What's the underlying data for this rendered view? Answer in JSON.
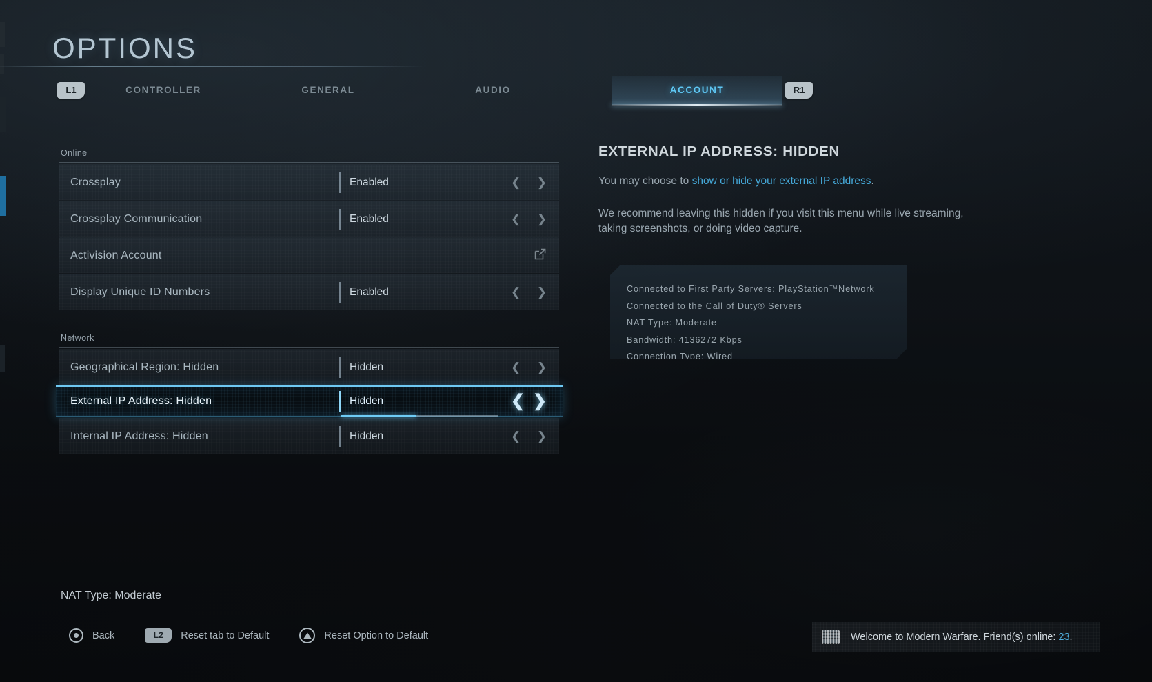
{
  "header": {
    "title": "OPTIONS"
  },
  "tabs": {
    "left_bumper": "L1",
    "right_bumper": "R1",
    "items": [
      {
        "label": "CONTROLLER",
        "active": false
      },
      {
        "label": "GENERAL",
        "active": false
      },
      {
        "label": "AUDIO",
        "active": false
      },
      {
        "label": "ACCOUNT",
        "active": true
      }
    ]
  },
  "options": {
    "groups": [
      {
        "label": "Online",
        "rows": [
          {
            "label": "Crossplay",
            "value": "Enabled",
            "control": "arrows",
            "selected": false
          },
          {
            "label": "Crossplay Communication",
            "value": "Enabled",
            "control": "arrows",
            "selected": false
          },
          {
            "label": "Activision Account",
            "value": "",
            "control": "external-link",
            "selected": false
          },
          {
            "label": "Display Unique ID Numbers",
            "value": "Enabled",
            "control": "arrows",
            "selected": false
          }
        ]
      },
      {
        "label": "Network",
        "rows": [
          {
            "label": "Geographical Region: Hidden",
            "value": "Hidden",
            "control": "arrows",
            "selected": false
          },
          {
            "label": "External IP Address: Hidden",
            "value": "Hidden",
            "control": "arrows",
            "selected": true,
            "slider_percent": 48
          },
          {
            "label": "Internal IP Address: Hidden",
            "value": "Hidden",
            "control": "arrows",
            "selected": false
          }
        ]
      }
    ]
  },
  "detail": {
    "title": "EXTERNAL IP ADDRESS: HIDDEN",
    "line1_prefix": "You may choose to ",
    "line1_highlight": "show or hide your external IP address",
    "line1_suffix": ".",
    "line2": "We recommend leaving this hidden if you visit this menu while live streaming, taking screenshots, or doing video capture."
  },
  "connection_info": {
    "lines": [
      "Connected to First Party Servers: PlayStation™Network",
      "Connected to the Call of Duty® Servers",
      "NAT Type: Moderate",
      "Bandwidth: 4136272 Kbps",
      "Connection Type: Wired"
    ]
  },
  "footer": {
    "nat_status": "NAT Type: Moderate",
    "prompts": [
      {
        "glyph": "circle-button",
        "label": "Back"
      },
      {
        "glyph": "L2",
        "label": "Reset tab to Default"
      },
      {
        "glyph": "triangle-button",
        "label": "Reset Option to Default"
      }
    ]
  },
  "toast": {
    "text_prefix": "Welcome to Modern Warfare. Friend(s) online: ",
    "count": "23",
    "text_suffix": "."
  },
  "colors": {
    "accent_cyan": "#5fc8f5",
    "link_blue": "#45a8d8",
    "text_primary": "#cfd7dc",
    "text_muted": "#9aa7b0"
  }
}
